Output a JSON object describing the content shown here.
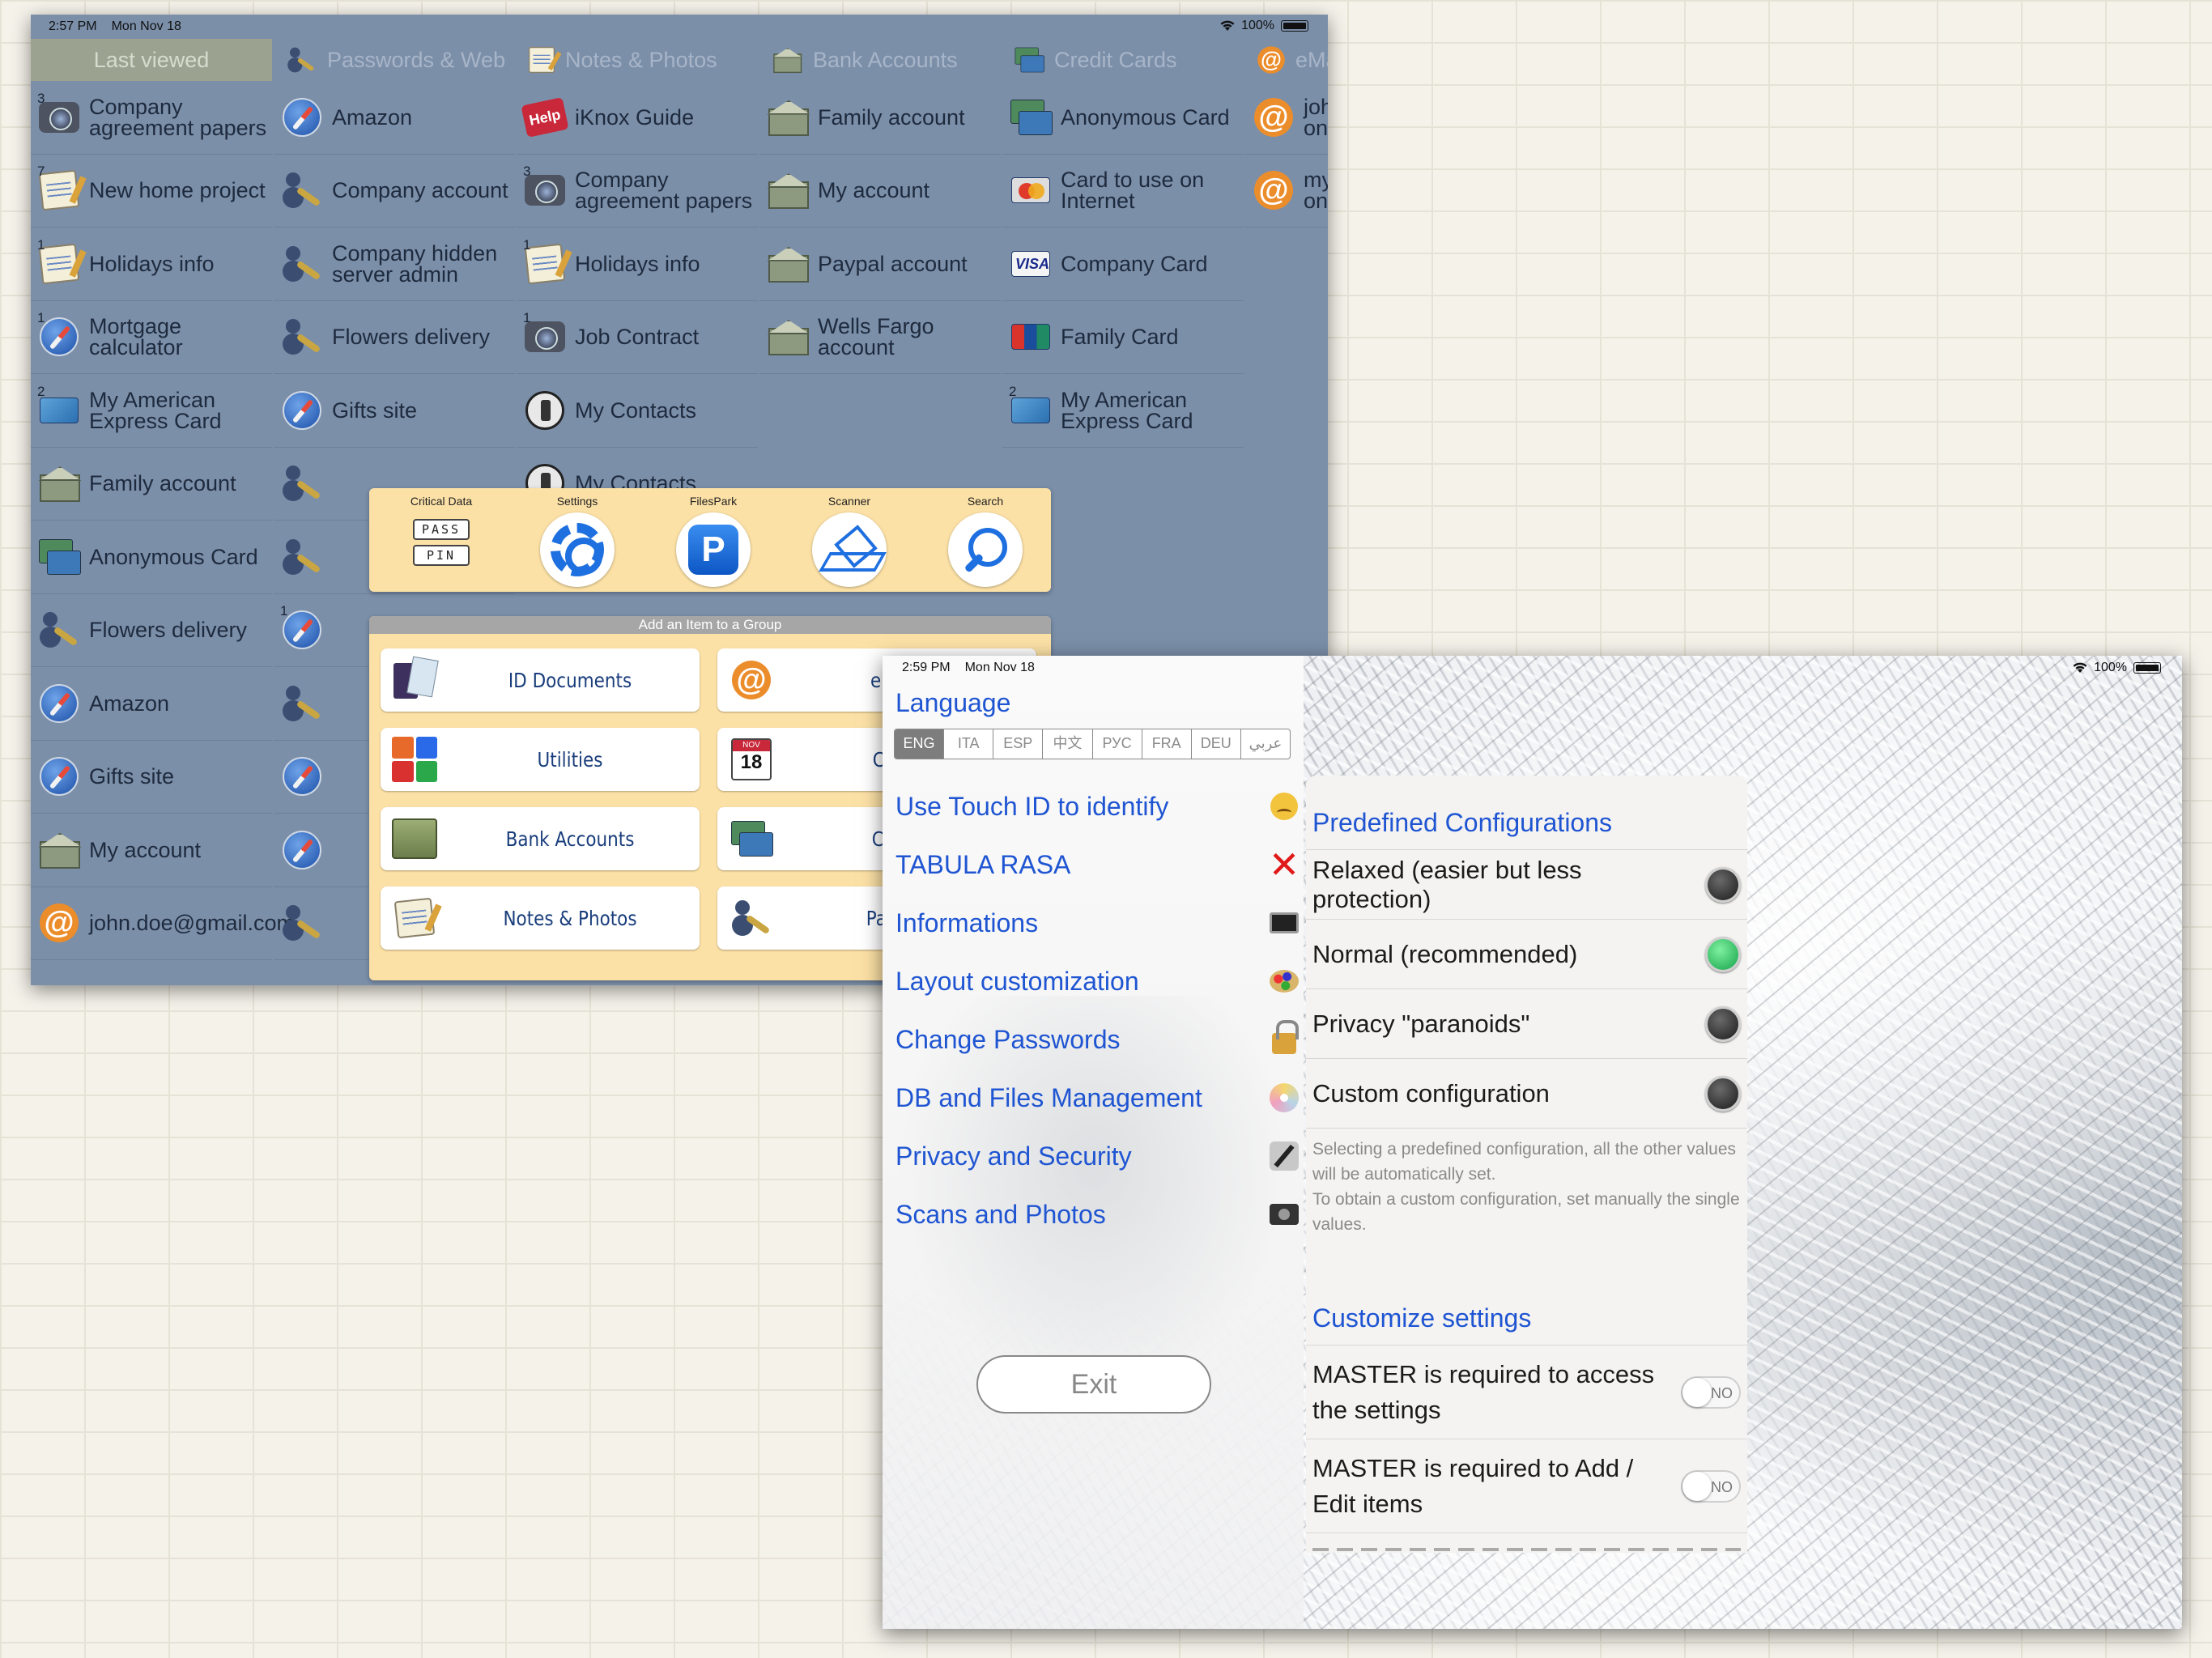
{
  "screen1": {
    "status": {
      "time": "2:57 PM",
      "date": "Mon Nov 18",
      "battery": "100%"
    },
    "columns": [
      {
        "header": "Last viewed",
        "icon": "",
        "active": true,
        "items": [
          {
            "label": "Company agreement papers",
            "badge": "3",
            "icon": "camera"
          },
          {
            "label": "New home project",
            "badge": "7",
            "icon": "notepad"
          },
          {
            "label": "Holidays info",
            "badge": "1",
            "icon": "notepad"
          },
          {
            "label": "Mortgage calculator",
            "badge": "1",
            "icon": "compass"
          },
          {
            "label": "My American Express Card",
            "badge": "2",
            "icon": "card-amex"
          },
          {
            "label": "Family account",
            "badge": "",
            "icon": "bank"
          },
          {
            "label": "Anonymous Card",
            "badge": "",
            "icon": "cards"
          },
          {
            "label": "Flowers delivery",
            "badge": "",
            "icon": "user-key"
          },
          {
            "label": "Amazon",
            "badge": "",
            "icon": "compass"
          },
          {
            "label": "Gifts site",
            "badge": "",
            "icon": "compass"
          },
          {
            "label": "My account",
            "badge": "",
            "icon": "bank"
          },
          {
            "label": "john.doe@gmail.com",
            "badge": "",
            "icon": "at"
          }
        ]
      },
      {
        "header": "Passwords & Web",
        "icon": "user-key",
        "active": false,
        "items": [
          {
            "label": "Amazon",
            "badge": "",
            "icon": "compass"
          },
          {
            "label": "Company account",
            "badge": "",
            "icon": "user-key"
          },
          {
            "label": "Company hidden server admin",
            "badge": "",
            "icon": "user-key"
          },
          {
            "label": "Flowers delivery",
            "badge": "",
            "icon": "user-key"
          },
          {
            "label": "Gifts site",
            "badge": "",
            "icon": "compass"
          },
          {
            "label": "",
            "badge": "",
            "icon": "user-key"
          },
          {
            "label": "",
            "badge": "",
            "icon": "user-key"
          },
          {
            "label": "",
            "badge": "1",
            "icon": "compass"
          },
          {
            "label": "",
            "badge": "",
            "icon": "user-key"
          },
          {
            "label": "",
            "badge": "",
            "icon": "compass"
          },
          {
            "label": "",
            "badge": "",
            "icon": "compass"
          },
          {
            "label": "",
            "badge": "",
            "icon": "user-key"
          }
        ]
      },
      {
        "header": "Notes & Photos",
        "icon": "notepad",
        "active": false,
        "items": [
          {
            "label": "iKnox Guide",
            "badge": "",
            "icon": "help"
          },
          {
            "label": "Company agreement papers",
            "badge": "3",
            "icon": "camera"
          },
          {
            "label": "Holidays info",
            "badge": "1",
            "icon": "notepad"
          },
          {
            "label": "Job Contract",
            "badge": "1",
            "icon": "camera"
          },
          {
            "label": "My Contacts",
            "badge": "",
            "icon": "phone"
          },
          {
            "label": "My Contacts",
            "badge": "",
            "icon": "phone"
          }
        ]
      },
      {
        "header": "Bank Accounts",
        "icon": "bank",
        "active": false,
        "items": [
          {
            "label": "Family account",
            "badge": "",
            "icon": "bank"
          },
          {
            "label": "My account",
            "badge": "",
            "icon": "bank"
          },
          {
            "label": "Paypal account",
            "badge": "",
            "icon": "bank"
          },
          {
            "label": "Wells Fargo account",
            "badge": "",
            "icon": "bank"
          }
        ]
      },
      {
        "header": "Credit Cards",
        "icon": "cards",
        "active": false,
        "items": [
          {
            "label": "Anonymous Card",
            "badge": "",
            "icon": "cards"
          },
          {
            "label": "Card to use on Internet",
            "badge": "",
            "icon": "card-master"
          },
          {
            "label": "Company Card",
            "badge": "",
            "icon": "card-visa"
          },
          {
            "label": "Family Card",
            "badge": "",
            "icon": "card-union"
          },
          {
            "label": "My American Express Card",
            "badge": "2",
            "icon": "card-amex"
          }
        ]
      },
      {
        "header": "eMa",
        "icon": "at",
        "active": false,
        "items": [
          {
            "label": "joh on",
            "badge": "",
            "icon": "at"
          },
          {
            "label": "my on",
            "badge": "",
            "icon": "at"
          }
        ]
      }
    ],
    "toolbar": [
      {
        "label": "Critical Data",
        "icon": "pass-pin-icon",
        "pass": "PASS",
        "pin": "PIN"
      },
      {
        "label": "Settings",
        "icon": "gear-icon"
      },
      {
        "label": "FilesPark",
        "icon": "p-icon",
        "glyph": "P"
      },
      {
        "label": "Scanner",
        "icon": "scanner-icon"
      },
      {
        "label": "Search",
        "icon": "search-icon"
      }
    ],
    "add_panel": {
      "title": "Add an Item to a Group",
      "items": [
        {
          "label": "ID Documents",
          "icon": "passport"
        },
        {
          "label": "eMail Ac",
          "icon": "at"
        },
        {
          "label": "Utilities",
          "icon": "utilities"
        },
        {
          "label": "Commit",
          "icon": "calendar"
        },
        {
          "label": "Bank Accounts",
          "icon": "money"
        },
        {
          "label": "Credit C",
          "icon": "cards"
        },
        {
          "label": "Notes & Photos",
          "icon": "notepad"
        },
        {
          "label": "Password",
          "icon": "user-key"
        }
      ]
    }
  },
  "screen2": {
    "status": {
      "time": "2:59 PM",
      "date": "Mon Nov 18",
      "battery": "100%"
    },
    "language": {
      "title": "Language",
      "options": [
        "ENG",
        "ITA",
        "ESP",
        "中文",
        "РУС",
        "FRA",
        "DEU",
        "عربي"
      ],
      "selected": "ENG"
    },
    "menu": [
      {
        "label": "Use Touch ID to identify",
        "icon": "face"
      },
      {
        "label": "TABULA RASA",
        "icon": "x"
      },
      {
        "label": "Informations",
        "icon": "laptop"
      },
      {
        "label": "Layout customization",
        "icon": "palette"
      },
      {
        "label": "Change Passwords",
        "icon": "lock"
      },
      {
        "label": "DB and Files Management",
        "icon": "disc"
      },
      {
        "label": "Privacy and Security",
        "icon": "pen"
      },
      {
        "label": "Scans and Photos",
        "icon": "camera"
      }
    ],
    "exit_label": "Exit",
    "predefined": {
      "title": "Predefined Configurations",
      "options": [
        {
          "label": "Relaxed (easier but less protection)",
          "on": false
        },
        {
          "label": "Normal (recommended)",
          "on": true
        },
        {
          "label": "Privacy \"paranoids\"",
          "on": false
        },
        {
          "label": "Custom configuration",
          "on": false
        }
      ],
      "note1": "Selecting a predefined configuration, all the other values will be automatically set.",
      "note2": "To obtain a custom configuration, set manually the single values."
    },
    "customize": {
      "title": "Customize settings",
      "settings": [
        {
          "label": "MASTER is required to access the settings",
          "value": "NO"
        },
        {
          "label": "MASTER is required to Add / Edit items",
          "value": "NO"
        }
      ]
    }
  }
}
